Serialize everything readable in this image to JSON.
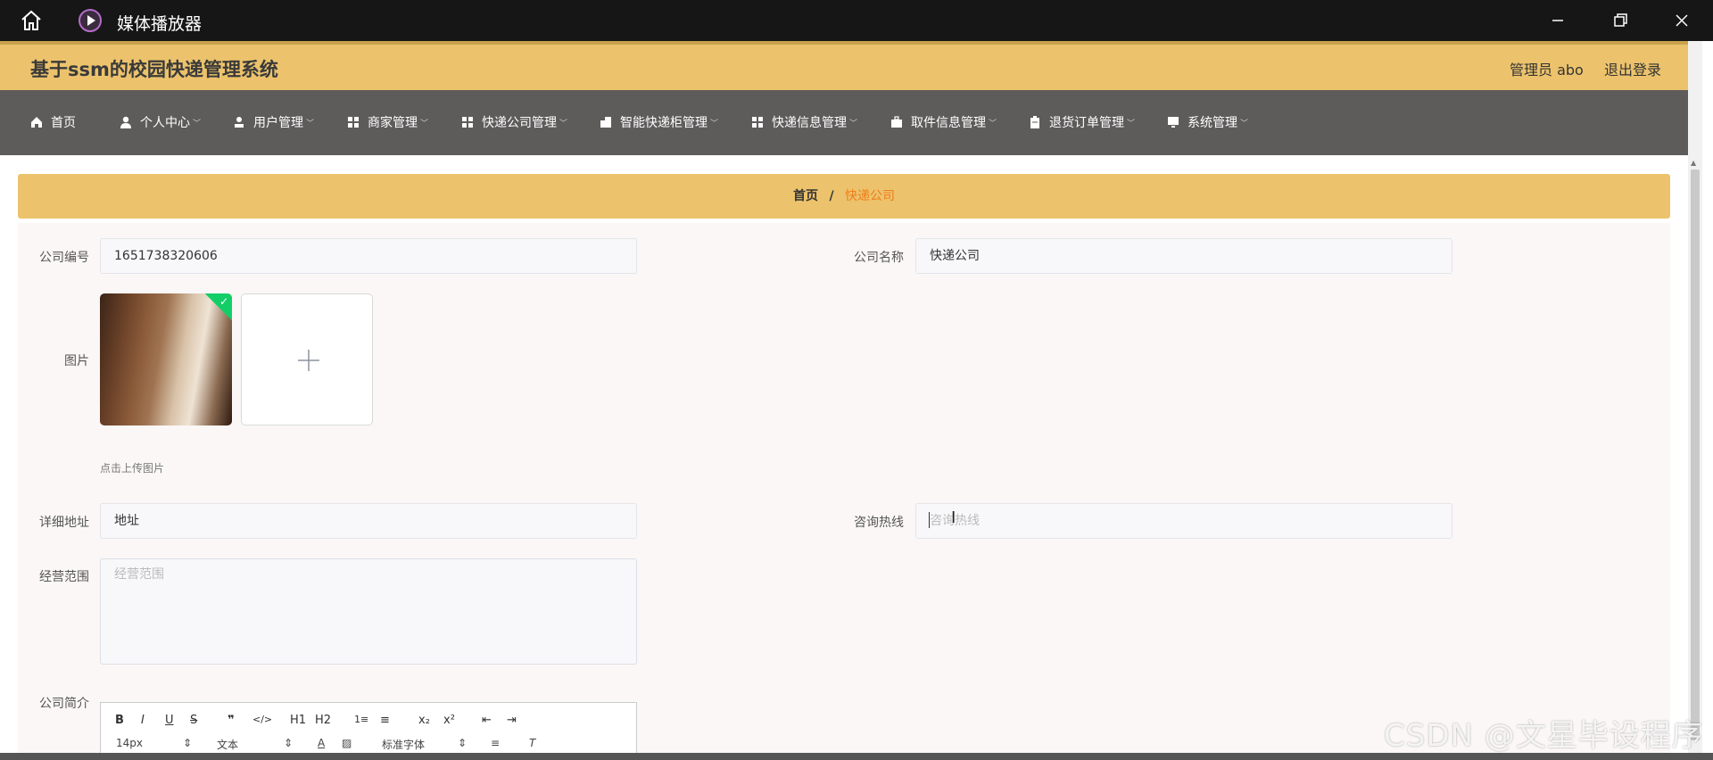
{
  "window": {
    "title": "媒体播放器"
  },
  "header": {
    "title": "基于ssm的校园快递管理系统",
    "admin": "管理员 abo",
    "logout": "退出登录"
  },
  "nav": {
    "items": [
      {
        "label": "首页",
        "icon": "home-icon"
      },
      {
        "label": "个人中心",
        "icon": "user-icon"
      },
      {
        "label": "用户管理",
        "icon": "user-icon"
      },
      {
        "label": "商家管理",
        "icon": "grid-icon"
      },
      {
        "label": "快递公司管理",
        "icon": "grid-icon"
      },
      {
        "label": "智能快递柜管理",
        "icon": "cabinet-icon"
      },
      {
        "label": "快递信息管理",
        "icon": "grid-icon"
      },
      {
        "label": "取件信息管理",
        "icon": "briefcase-icon"
      },
      {
        "label": "退货订单管理",
        "icon": "clipboard-icon"
      },
      {
        "label": "系统管理",
        "icon": "monitor-icon"
      }
    ]
  },
  "breadcrumb": {
    "home": "首页",
    "separator": "/",
    "current": "快递公司"
  },
  "form": {
    "company_no_label": "公司编号",
    "company_no_value": "1651738320606",
    "company_name_label": "公司名称",
    "company_name_value": "快递公司",
    "image_label": "图片",
    "upload_tip": "点击上传图片",
    "address_label": "详细地址",
    "address_value": "地址",
    "hotline_label": "咨询热线",
    "hotline_placeholder": "咨询热线",
    "scope_label": "经营范围",
    "scope_placeholder": "经营范围",
    "intro_label": "公司简介"
  },
  "editor": {
    "toolbar_row1": [
      "B",
      "I",
      "U",
      "S",
      "❞",
      "</>",
      "H1",
      "H2",
      "1≡",
      "≡",
      "x₂",
      "x²",
      "⇤",
      "⇥"
    ],
    "font_size": "14px",
    "text_type": "文本",
    "font_family": "标准字体"
  },
  "watermark": "CSDN @文星毕设程序",
  "colors": {
    "header": "#ecc36c",
    "nav": "#5e5b5b",
    "accent": "#f07d19",
    "success": "#13ce66"
  }
}
